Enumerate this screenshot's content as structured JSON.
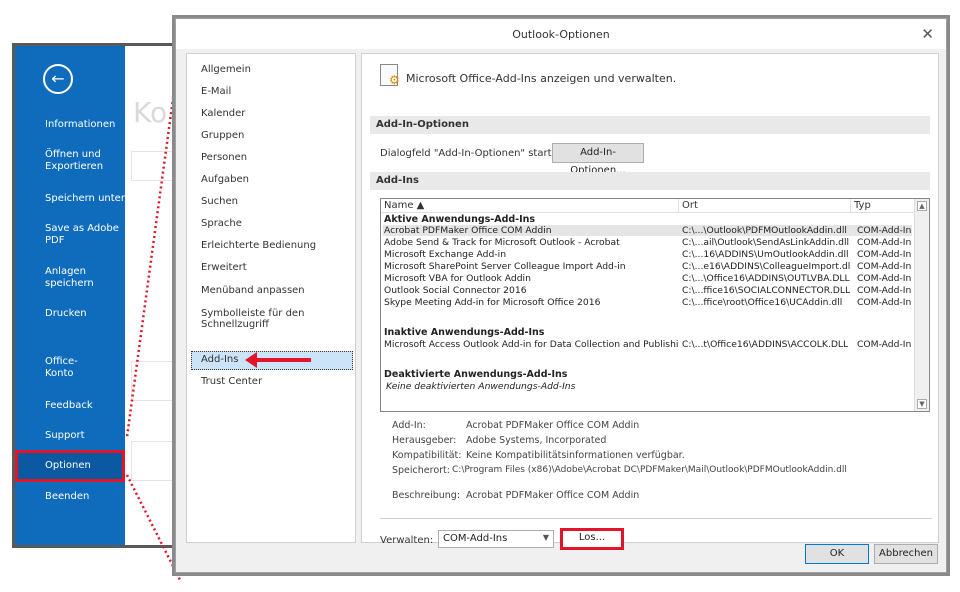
{
  "backstage": {
    "back_icon": "arrow-left-circle-icon",
    "ghost_text": "Ko",
    "items": [
      {
        "label": "Informationen"
      },
      {
        "label": "Öffnen und\nExportieren"
      },
      {
        "label": "Speichern unter"
      },
      {
        "label": "Save as Adobe\nPDF"
      },
      {
        "label": "Anlagen\nspeichern"
      },
      {
        "label": "Drucken"
      },
      {
        "label": "Office-\nKonto"
      },
      {
        "label": "Feedback"
      },
      {
        "label": "Support"
      },
      {
        "label": "Optionen"
      },
      {
        "label": "Beenden"
      }
    ],
    "selected": "Optionen",
    "accent": "#0f6cbd",
    "highlight": "#e0152a"
  },
  "dialog": {
    "title": "Outlook-Optionen",
    "close": "✕",
    "nav": [
      "Allgemein",
      "E-Mail",
      "Kalender",
      "Gruppen",
      "Personen",
      "Aufgaben",
      "Suchen",
      "Sprache",
      "Erleichterte Bedienung",
      "Erweitert",
      "Menüband anpassen",
      "Symbolleiste für den Schnellzugriff",
      "Add-Ins",
      "Trust Center"
    ],
    "nav_selected": "Add-Ins",
    "heading": "Microsoft Office-Add-Ins anzeigen und verwalten.",
    "section_options": "Add-In-Optionen",
    "options_label": "Dialogfeld \"Add-In-Optionen\" starten:",
    "options_button": "Add-In-Optionen...",
    "section_addins": "Add-Ins",
    "columns": [
      "Name ▲",
      "Ort",
      "Typ"
    ],
    "groups": [
      {
        "title": "Aktive Anwendungs-Add-Ins",
        "rows": [
          {
            "name": "Acrobat PDFMaker Office COM Addin",
            "loc": "C:\\...\\Outlook\\PDFMOutlookAddin.dll",
            "type": "COM-Add-In",
            "selected": true
          },
          {
            "name": "Adobe Send & Track for Microsoft Outlook - Acrobat",
            "loc": "C:\\...ail\\Outlook\\SendAsLinkAddin.dll",
            "type": "COM-Add-In"
          },
          {
            "name": "Microsoft Exchange Add-in",
            "loc": "C:\\...16\\ADDINS\\UmOutlookAddin.dll",
            "type": "COM-Add-In"
          },
          {
            "name": "Microsoft SharePoint Server Colleague Import Add-in",
            "loc": "C:\\...e16\\ADDINS\\ColleagueImport.dll",
            "type": "COM-Add-In"
          },
          {
            "name": "Microsoft VBA for Outlook Addin",
            "loc": "C:\\...\\Office16\\ADDINS\\OUTLVBA.DLL",
            "type": "COM-Add-In"
          },
          {
            "name": "Outlook Social Connector 2016",
            "loc": "C:\\...ffice16\\SOCIALCONNECTOR.DLL",
            "type": "COM-Add-In"
          },
          {
            "name": "Skype Meeting Add-in for Microsoft Office 2016",
            "loc": "C:\\...ffice\\root\\Office16\\UCAddin.dll",
            "type": "COM-Add-In"
          }
        ]
      },
      {
        "title": "Inaktive Anwendungs-Add-Ins",
        "rows": [
          {
            "name": "Microsoft Access Outlook Add-in for Data Collection and Publishing",
            "loc": "C:\\...t\\Office16\\ADDINS\\ACCOLK.DLL",
            "type": "COM-Add-In"
          }
        ]
      },
      {
        "title": "Deaktivierte Anwendungs-Add-Ins",
        "empty": "Keine deaktivierten Anwendungs-Add-Ins"
      }
    ],
    "details": {
      "addin_label": "Add-In:",
      "addin_value": "Acrobat PDFMaker Office COM Addin",
      "publisher_label": "Herausgeber:",
      "publisher_value": "Adobe Systems, Incorporated",
      "compat_label": "Kompatibilität:",
      "compat_value": "Keine Kompatibilitätsinformationen verfügbar.",
      "location_label": "Speicherort:",
      "location_value": "C:\\Program Files (x86)\\Adobe\\Acrobat DC\\PDFMaker\\Mail\\Outlook\\PDFMOutlookAddin.dll",
      "desc_label": "Beschreibung:",
      "desc_value": "Acrobat PDFMaker Office COM Addin"
    },
    "manage_label": "Verwalten:",
    "manage_value": "COM-Add-Ins",
    "go_button": "Los...",
    "ok_button": "OK",
    "cancel_button": "Abbrechen"
  }
}
